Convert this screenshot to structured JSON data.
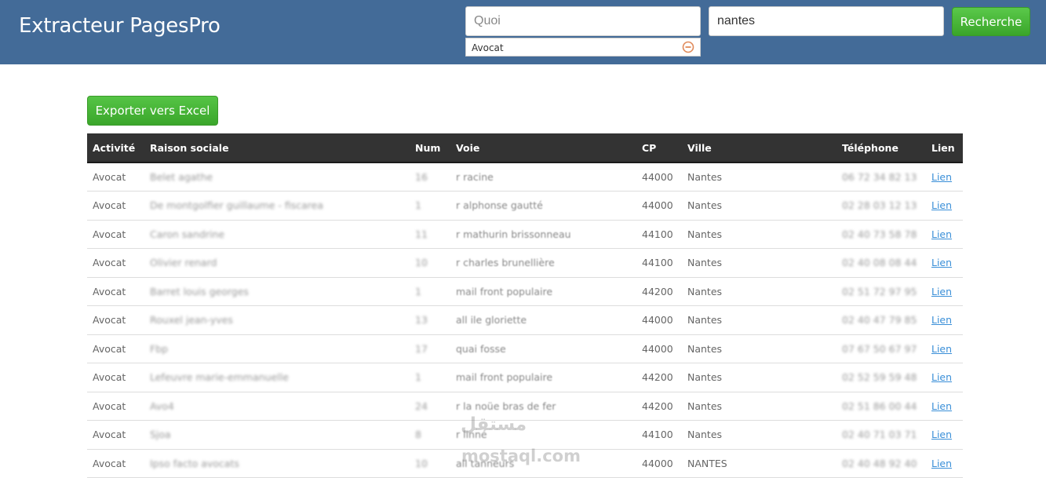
{
  "brand": "Extracteur PagesPro",
  "search": {
    "what_placeholder": "Quoi",
    "where_value": "nantes",
    "button_label": "Recherche",
    "selected_tag": "Avocat"
  },
  "export_label": "Exporter vers Excel",
  "table": {
    "headers": [
      "Activité",
      "Raison sociale",
      "Num",
      "Voie",
      "CP",
      "Ville",
      "Téléphone",
      "Lien"
    ],
    "rows": [
      [
        "Avocat",
        "Belet agathe",
        "16",
        "r racine",
        "44000",
        "Nantes",
        "06 72 34 82 13",
        "Lien"
      ],
      [
        "Avocat",
        "De montgolfier guillaume - fiscarea",
        "1",
        "r alphonse gautté",
        "44000",
        "Nantes",
        "02 28 03 12 13",
        "Lien"
      ],
      [
        "Avocat",
        "Caron sandrine",
        "11",
        "r mathurin brissonneau",
        "44100",
        "Nantes",
        "02 40 73 58 78",
        "Lien"
      ],
      [
        "Avocat",
        "Olivier renard",
        "10",
        "r charles brunellière",
        "44100",
        "Nantes",
        "02 40 08 08 44",
        "Lien"
      ],
      [
        "Avocat",
        "Barret louis georges",
        "1",
        "mail front populaire",
        "44200",
        "Nantes",
        "02 51 72 97 95",
        "Lien"
      ],
      [
        "Avocat",
        "Rouxel jean-yves",
        "13",
        "all ile gloriette",
        "44000",
        "Nantes",
        "02 40 47 79 85",
        "Lien"
      ],
      [
        "Avocat",
        "Fbp",
        "17",
        "quai fosse",
        "44000",
        "Nantes",
        "07 67 50 67 97",
        "Lien"
      ],
      [
        "Avocat",
        "Lefeuvre marie-emmanuelle",
        "1",
        "mail front populaire",
        "44200",
        "Nantes",
        "02 52 59 59 48",
        "Lien"
      ],
      [
        "Avocat",
        "Avo4",
        "24",
        "r la noüe bras de fer",
        "44200",
        "Nantes",
        "02 51 86 00 44",
        "Lien"
      ],
      [
        "Avocat",
        "Sjoa",
        "8",
        "r linné",
        "44100",
        "Nantes",
        "02 40 71 03 71",
        "Lien"
      ],
      [
        "Avocat",
        "Ipso facto avocats",
        "10",
        "all tanneurs",
        "44000",
        "NANTES",
        "02 40 48 92 40",
        "Lien"
      ]
    ]
  },
  "watermark": {
    "arabic": "مستقل",
    "latin": "mostaql.com"
  },
  "colors": {
    "navbar": "#436b98",
    "button_green": "#3aa52a",
    "table_header": "#333333",
    "link": "#3a8fd8"
  }
}
